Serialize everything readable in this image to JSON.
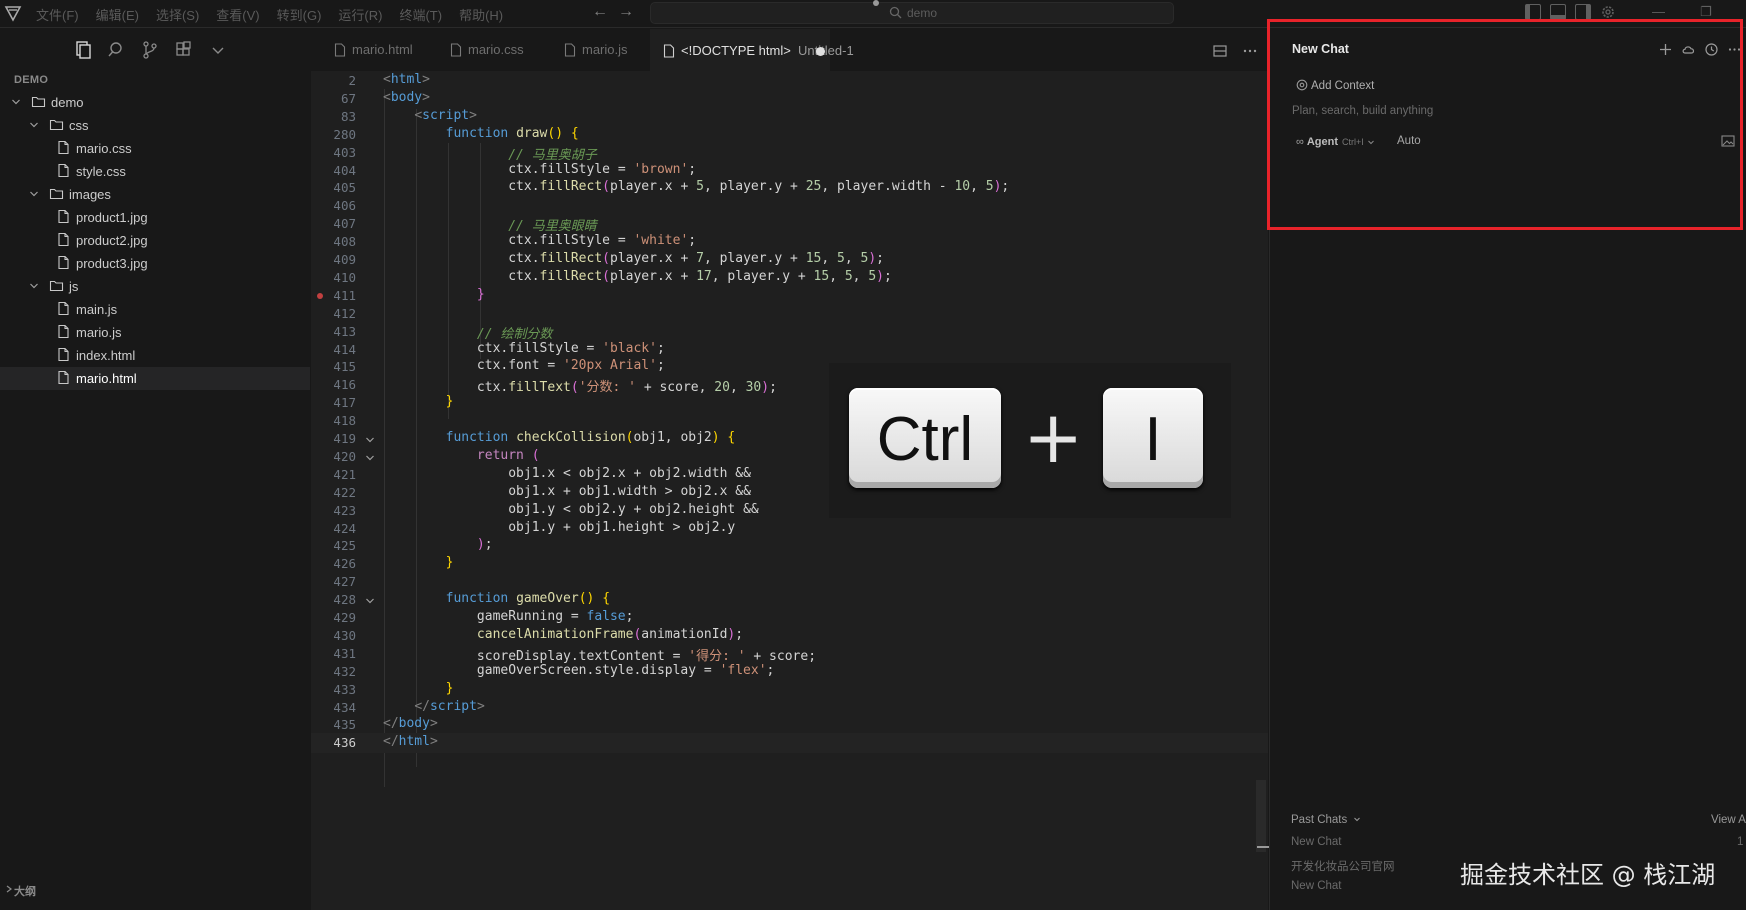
{
  "titlebar": {
    "menu": [
      "文件(F)",
      "编辑(E)",
      "选择(S)",
      "查看(V)",
      "转到(G)",
      "运行(R)",
      "终端(T)",
      "帮助(H)"
    ],
    "search_text": "demo"
  },
  "sidebar": {
    "section_title": "DEMO",
    "tree": [
      {
        "label": "demo",
        "type": "folder",
        "depth": 0,
        "expanded": true
      },
      {
        "label": "css",
        "type": "folder",
        "depth": 1,
        "expanded": true
      },
      {
        "label": "mario.css",
        "type": "file",
        "depth": 2
      },
      {
        "label": "style.css",
        "type": "file",
        "depth": 2
      },
      {
        "label": "images",
        "type": "folder",
        "depth": 1,
        "expanded": true
      },
      {
        "label": "product1.jpg",
        "type": "file",
        "depth": 2
      },
      {
        "label": "product2.jpg",
        "type": "file",
        "depth": 2
      },
      {
        "label": "product3.jpg",
        "type": "file",
        "depth": 2
      },
      {
        "label": "js",
        "type": "folder",
        "depth": 1,
        "expanded": true
      },
      {
        "label": "main.js",
        "type": "file",
        "depth": 2
      },
      {
        "label": "mario.js",
        "type": "file",
        "depth": 2
      },
      {
        "label": "index.html",
        "type": "file",
        "depth": 1
      },
      {
        "label": "mario.html",
        "type": "file",
        "depth": 1,
        "selected": true
      }
    ],
    "outline_label": "大纲"
  },
  "tabs": [
    {
      "label": "mario.html",
      "active": false
    },
    {
      "label": "mario.css",
      "active": false
    },
    {
      "label": "mario.js",
      "active": false
    },
    {
      "label": "<!DOCTYPE html>",
      "sub": "Untitled-1",
      "active": true,
      "dirty": true
    }
  ],
  "editor": {
    "lines": [
      {
        "n": "2",
        "html": "<span class='tg'>&lt;</span><span class='tn'>html</span><span class='tg'>&gt;</span>"
      },
      {
        "n": "67",
        "html": "<span class='tg'>&lt;</span><span class='tn'>body</span><span class='tg'>&gt;</span>"
      },
      {
        "n": "83",
        "html": "    <span class='tg'>&lt;</span><span class='tn'>script</span><span class='tg'>&gt;</span>"
      },
      {
        "n": "280",
        "html": "        <span class='kw'>function</span> <span class='fn'>draw</span><span class='br1'>()</span> <span class='br1'>{</span>"
      },
      {
        "n": "403",
        "html": "                <span class='cm'>// 马里奥胡子</span>"
      },
      {
        "n": "404",
        "html": "                <span class='var'>ctx</span>.<span class='var'>fillStyle</span> = <span class='str'>'brown'</span>;"
      },
      {
        "n": "405",
        "html": "                <span class='var'>ctx</span>.<span class='fn'>fillRect</span><span class='br2'>(</span><span class='var'>player</span>.<span class='var'>x</span> + <span class='num'>5</span>, <span class='var'>player</span>.<span class='var'>y</span> + <span class='num'>25</span>, <span class='var'>player</span>.<span class='var'>width</span> - <span class='num'>10</span>, <span class='num'>5</span><span class='br2'>)</span>;"
      },
      {
        "n": "406",
        "html": ""
      },
      {
        "n": "407",
        "html": "                <span class='cm'>// 马里奥眼睛</span>"
      },
      {
        "n": "408",
        "html": "                <span class='var'>ctx</span>.<span class='var'>fillStyle</span> = <span class='str'>'white'</span>;"
      },
      {
        "n": "409",
        "html": "                <span class='var'>ctx</span>.<span class='fn'>fillRect</span><span class='br2'>(</span><span class='var'>player</span>.<span class='var'>x</span> + <span class='num'>7</span>, <span class='var'>player</span>.<span class='var'>y</span> + <span class='num'>15</span>, <span class='num'>5</span>, <span class='num'>5</span><span class='br2'>)</span>;"
      },
      {
        "n": "410",
        "html": "                <span class='var'>ctx</span>.<span class='fn'>fillRect</span><span class='br2'>(</span><span class='var'>player</span>.<span class='var'>x</span> + <span class='num'>17</span>, <span class='var'>player</span>.<span class='var'>y</span> + <span class='num'>15</span>, <span class='num'>5</span>, <span class='num'>5</span><span class='br2'>)</span>;"
      },
      {
        "n": "411",
        "html": "            <span class='br2'>}</span>",
        "bp": true
      },
      {
        "n": "412",
        "html": ""
      },
      {
        "n": "413",
        "html": "            <span class='cm'>// 绘制分数</span>"
      },
      {
        "n": "414",
        "html": "            <span class='var'>ctx</span>.<span class='var'>fillStyle</span> = <span class='str'>'black'</span>;"
      },
      {
        "n": "415",
        "html": "            <span class='var'>ctx</span>.<span class='var'>font</span> = <span class='str'>'20px Arial'</span>;"
      },
      {
        "n": "416",
        "html": "            <span class='var'>ctx</span>.<span class='fn'>fillText</span><span class='br2'>(</span><span class='str'>'分数: '</span> + <span class='var'>score</span>, <span class='num'>20</span>, <span class='num'>30</span><span class='br2'>)</span>;"
      },
      {
        "n": "417",
        "html": "        <span class='br1'>}</span>"
      },
      {
        "n": "418",
        "html": ""
      },
      {
        "n": "419",
        "html": "        <span class='kw'>function</span> <span class='fn'>checkCollision</span><span class='br1'>(</span><span class='var'>obj1</span>, <span class='var'>obj2</span><span class='br1'>)</span> <span class='br1'>{</span>",
        "fold": true
      },
      {
        "n": "420",
        "html": "            <span class='ctl'>return</span> <span class='br2'>(</span>",
        "fold": true
      },
      {
        "n": "421",
        "html": "                <span class='var'>obj1</span>.<span class='var'>x</span> &lt; <span class='var'>obj2</span>.<span class='var'>x</span> + <span class='var'>obj2</span>.<span class='var'>width</span> &amp;&amp;"
      },
      {
        "n": "422",
        "html": "                <span class='var'>obj1</span>.<span class='var'>x</span> + <span class='var'>obj1</span>.<span class='var'>width</span> &gt; <span class='var'>obj2</span>.<span class='var'>x</span> &amp;&amp;"
      },
      {
        "n": "423",
        "html": "                <span class='var'>obj1</span>.<span class='var'>y</span> &lt; <span class='var'>obj2</span>.<span class='var'>y</span> + <span class='var'>obj2</span>.<span class='var'>height</span> &amp;&amp;"
      },
      {
        "n": "424",
        "html": "                <span class='var'>obj1</span>.<span class='var'>y</span> + <span class='var'>obj1</span>.<span class='var'>height</span> &gt; <span class='var'>obj2</span>.<span class='var'>y</span>"
      },
      {
        "n": "425",
        "html": "            <span class='br2'>)</span>;"
      },
      {
        "n": "426",
        "html": "        <span class='br1'>}</span>"
      },
      {
        "n": "427",
        "html": ""
      },
      {
        "n": "428",
        "html": "        <span class='kw'>function</span> <span class='fn'>gameOver</span><span class='br1'>()</span> <span class='br1'>{</span>",
        "fold": true
      },
      {
        "n": "429",
        "html": "            <span class='var'>gameRunning</span> = <span class='kw'>false</span>;"
      },
      {
        "n": "430",
        "html": "            <span class='fn'>cancelAnimationFrame</span><span class='br2'>(</span><span class='var'>animationId</span><span class='br2'>)</span>;"
      },
      {
        "n": "431",
        "html": "            <span class='var'>scoreDisplay</span>.<span class='var'>textContent</span> = <span class='str'>'得分: '</span> + <span class='var'>score</span>;"
      },
      {
        "n": "432",
        "html": "            <span class='var'>gameOverScreen</span>.<span class='var'>style</span>.<span class='var'>display</span> = <span class='str'>'flex'</span>;"
      },
      {
        "n": "433",
        "html": "        <span class='br1'>}</span>"
      },
      {
        "n": "434",
        "html": "    <span class='tg'>&lt;/</span><span class='tn'>script</span><span class='tg'>&gt;</span>"
      },
      {
        "n": "435",
        "html": "<span class='tg'>&lt;/</span><span class='tn'>body</span><span class='tg'>&gt;</span>"
      },
      {
        "n": "436",
        "html": "<span class='tg'>&lt;/</span><span class='tn'>html</span><span class='tg'>&gt;</span>",
        "current": true
      }
    ]
  },
  "overlay": {
    "key1": "Ctrl",
    "plus": "+",
    "key2": "I"
  },
  "chat": {
    "title": "New Chat",
    "add_context": "Add Context",
    "input_placeholder": "Plan, search, build anything",
    "agent_label": "Agent",
    "agent_shortcut": "Ctrl+I",
    "model_label": "Auto",
    "past_chats_label": "Past Chats",
    "view_all_label": "View All",
    "past_chats": [
      {
        "title": "New Chat",
        "time": "1"
      },
      {
        "title": "开发化妆品公司官网",
        "time": ""
      },
      {
        "title": "New Chat",
        "time": ""
      }
    ]
  },
  "watermark": "掘金技术社区 @ 栈江湖",
  "colors": {
    "highlight_frame": "#e8232a",
    "editor_bg": "#1f1f1f",
    "sidebar_bg": "#181818"
  }
}
